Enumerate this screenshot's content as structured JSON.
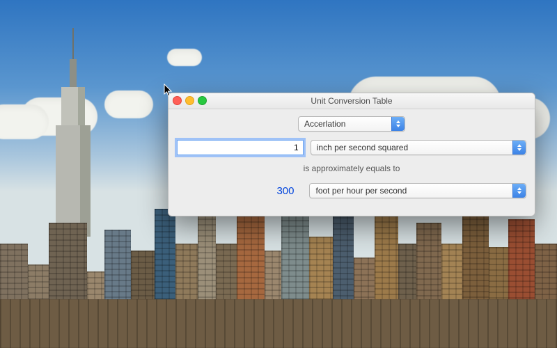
{
  "window": {
    "title": "Unit Conversion Table",
    "category": "Accerlation",
    "input_value": "1",
    "from_unit": "inch per second squared",
    "approx_text": "is approximately equals to",
    "result_value": "300",
    "to_unit": "foot per hour per second"
  }
}
